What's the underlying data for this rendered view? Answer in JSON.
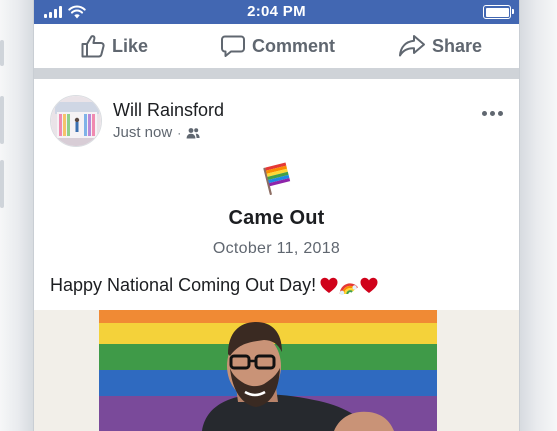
{
  "status_bar": {
    "time": "2:04 PM"
  },
  "actions": {
    "like_label": "Like",
    "comment_label": "Comment",
    "share_label": "Share"
  },
  "post": {
    "author": "Will Rainsford",
    "timestamp": "Just now",
    "separator": "·",
    "audience_icon": "friends-icon",
    "life_event": {
      "icon": "rainbow-flag-icon",
      "title": "Came Out",
      "date": "October 11, 2018"
    },
    "text": "Happy National Coming Out Day!",
    "emojis": [
      "heart-emoji",
      "rainbow-emoji",
      "heart-emoji"
    ]
  },
  "colors": {
    "brand_blue": "#4267b2",
    "secondary_text": "#606770",
    "primary_text": "#1c1e21",
    "heart_red": "#d0021b"
  }
}
